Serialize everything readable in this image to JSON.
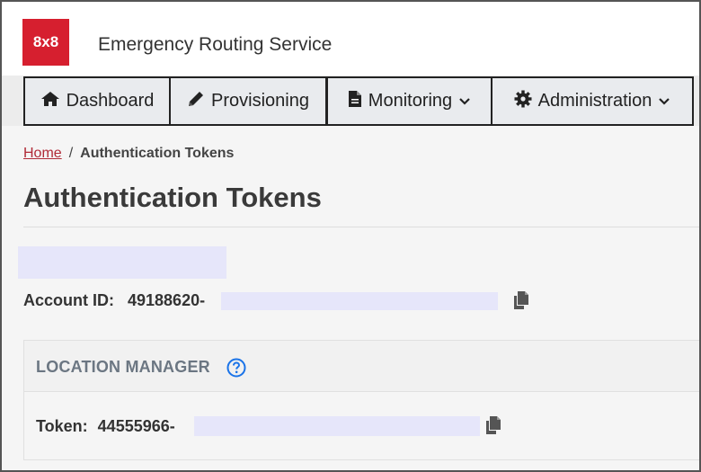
{
  "brand": {
    "logo_text": "8x8",
    "app_title": "Emergency Routing Service",
    "accent": "#d61f2f"
  },
  "nav": {
    "items": [
      {
        "label": "Dashboard",
        "icon": "home-icon"
      },
      {
        "label": "Provisioning",
        "icon": "pencil-icon"
      },
      {
        "label": "Monitoring",
        "icon": "document-icon",
        "dropdown": true
      },
      {
        "label": "Administration",
        "icon": "gear-icon",
        "dropdown": true
      }
    ]
  },
  "breadcrumb": {
    "home": "Home",
    "separator": "/",
    "current": "Authentication Tokens"
  },
  "page": {
    "title": "Authentication Tokens"
  },
  "account": {
    "label": "Account ID:",
    "value_prefix": "49188620-"
  },
  "location_manager": {
    "title": "LOCATION MANAGER",
    "token_label": "Token:",
    "token_prefix": "44555966-"
  },
  "colors": {
    "redaction": "#e6e6fa",
    "link": "#b02a37",
    "help": "#1a73e8"
  }
}
